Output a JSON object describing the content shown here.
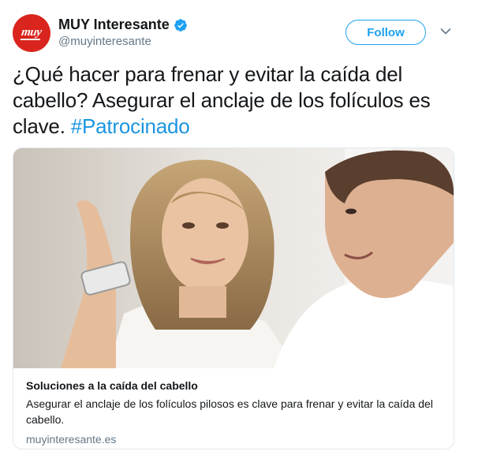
{
  "account": {
    "display_name": "MUY Interesante",
    "handle": "@muyinteresante",
    "avatar_text": "muy",
    "verified_icon": "verified-badge-icon",
    "brand_color": "#d9251d"
  },
  "actions": {
    "follow_label": "Follow",
    "more_icon": "chevron-down-icon"
  },
  "tweet": {
    "text": "¿Qué hacer para frenar y evitar la caída del cabello? Asegurar el anclaje de los folículos es clave. ",
    "hashtag": "#Patrocinado",
    "hashtag_color": "#1b95e0"
  },
  "card": {
    "image_alt": "photo-woman-and-man",
    "title": "Soluciones a la caída del cabello",
    "description": "Asegurar el anclaje de los folículos pilosos es clave para frenar y evitar la caída del cabello.",
    "domain": "muyinteresante.es"
  }
}
